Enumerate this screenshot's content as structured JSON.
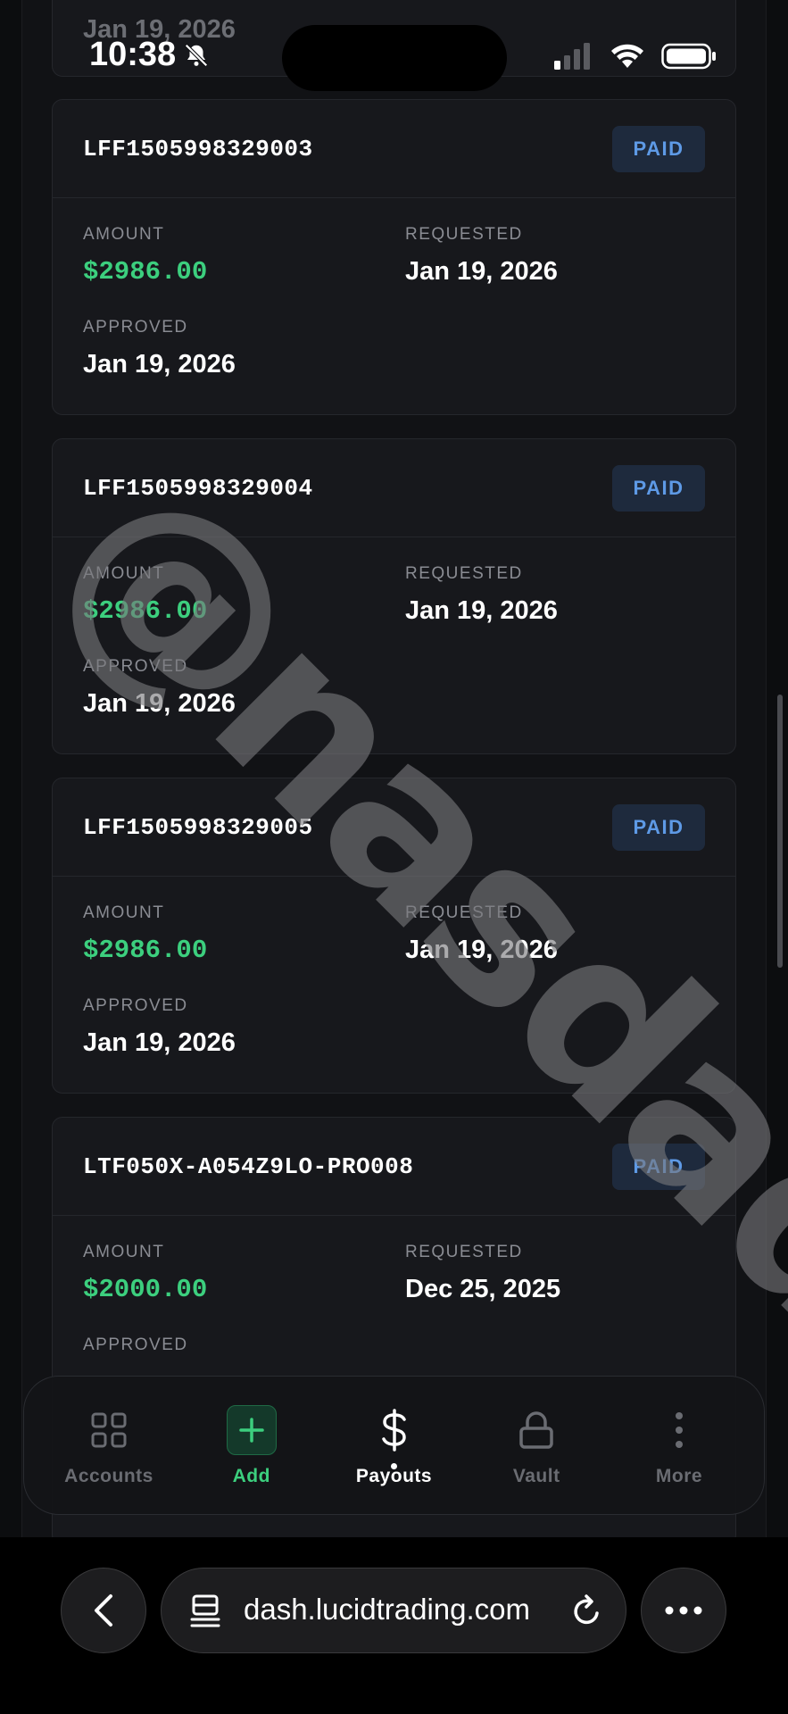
{
  "status_bar": {
    "time": "10:38"
  },
  "partial_card": {
    "date": "Jan 19, 2026"
  },
  "labels": {
    "amount": "AMOUNT",
    "requested": "REQUESTED",
    "approved": "APPROVED"
  },
  "payouts": [
    {
      "id": "LFF1505998329003",
      "status": "PAID",
      "amount": "$2986.00",
      "requested": "Jan 19, 2026",
      "approved": "Jan 19, 2026"
    },
    {
      "id": "LFF1505998329004",
      "status": "PAID",
      "amount": "$2986.00",
      "requested": "Jan 19, 2026",
      "approved": "Jan 19, 2026"
    },
    {
      "id": "LFF1505998329005",
      "status": "PAID",
      "amount": "$2986.00",
      "requested": "Jan 19, 2026",
      "approved": "Jan 19, 2026"
    },
    {
      "id": "LTF050X-A054Z9LO-PRO008",
      "status": "PAID",
      "amount": "$2000.00",
      "requested": "Dec 25, 2025",
      "approved": ""
    }
  ],
  "watermark": "@nasdadale",
  "bottom_nav": {
    "items": [
      {
        "label": "Accounts",
        "icon": "grid-icon"
      },
      {
        "label": "Add",
        "icon": "plus-icon"
      },
      {
        "label": "Payouts",
        "icon": "dollar-icon"
      },
      {
        "label": "Vault",
        "icon": "lock-icon"
      },
      {
        "label": "More",
        "icon": "more-vertical-icon"
      }
    ],
    "active": "Payouts"
  },
  "browser": {
    "url": "dash.lucidtrading.com"
  },
  "colors": {
    "accent_green": "#3ccf7e",
    "badge_blue": "#5e9ae6",
    "background": "#0c0d0f"
  }
}
